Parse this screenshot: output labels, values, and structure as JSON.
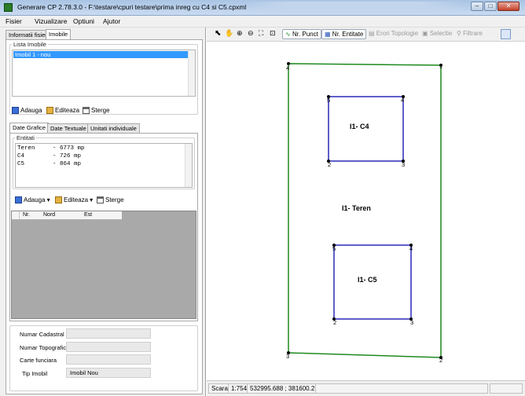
{
  "window": {
    "title": "Generare CP 2.78.3.0 - F:\\testare\\cpuri testare\\prima inreg cu C4 si C5.cpxml",
    "controls": {
      "minimize": "–",
      "maximize": "□",
      "close": "✕"
    }
  },
  "menu": [
    "Fisier",
    "Vizualizare",
    "Optiuni",
    "Ajutor"
  ],
  "left_tabs": {
    "info": "Informatii fisier",
    "imobile": "Imobile"
  },
  "lista_imobile": {
    "title": "Lista Imobile",
    "items": [
      "Imobil 1 - nou"
    ],
    "buttons": {
      "add": "Adauga",
      "edit": "Editeaza",
      "delete": "Sterge"
    }
  },
  "data_tabs": {
    "grafice": "Date Grafice",
    "textuale": "Date Textuale",
    "unitati": "Unitati individuale"
  },
  "entitati": {
    "title": "Entitati",
    "lines": [
      "Teren     - 6773 mp",
      "C4        - 726 mp",
      "C5        - 864 mp"
    ],
    "buttons": {
      "add": "Adauga",
      "edit": "Editeaza",
      "delete": "Sterge"
    }
  },
  "coord_table": {
    "headers": [
      "Nr.",
      "Nord",
      "Est"
    ]
  },
  "imobil_fields": {
    "numar_cadastral": {
      "label": "Numar Cadastral",
      "value": ""
    },
    "numar_topografic": {
      "label": "Numar Topografic",
      "value": ""
    },
    "carte_funciara": {
      "label": "Carte funciara",
      "value": ""
    },
    "tip_imobil": {
      "label": "Tip Imobil",
      "value": "Imobil Nou"
    }
  },
  "toolbar": {
    "nr_punct": "Nr. Punct",
    "nr_entitate": "Nr. Entitate",
    "erori": "Erori Topologie",
    "selectie": "Selectie",
    "filtrare": "Filtrare"
  },
  "map": {
    "teren": {
      "label": "I1- Teren",
      "vertices": [
        "1",
        "2",
        "3",
        "4"
      ],
      "color": "#1e8a1e"
    },
    "c4": {
      "label": "I1- C4",
      "vertices": [
        "1",
        "2",
        "3",
        "4",
        "5"
      ],
      "color": "#2a2ab8"
    },
    "c5": {
      "label": "I1- C5",
      "vertices": [
        "1",
        "2",
        "3",
        "4",
        "5"
      ],
      "color": "#2a2ab8"
    }
  },
  "status": {
    "scara_label": "Scara",
    "scara_value": "1:754",
    "coords": "532995.688 ; 381600.219"
  }
}
